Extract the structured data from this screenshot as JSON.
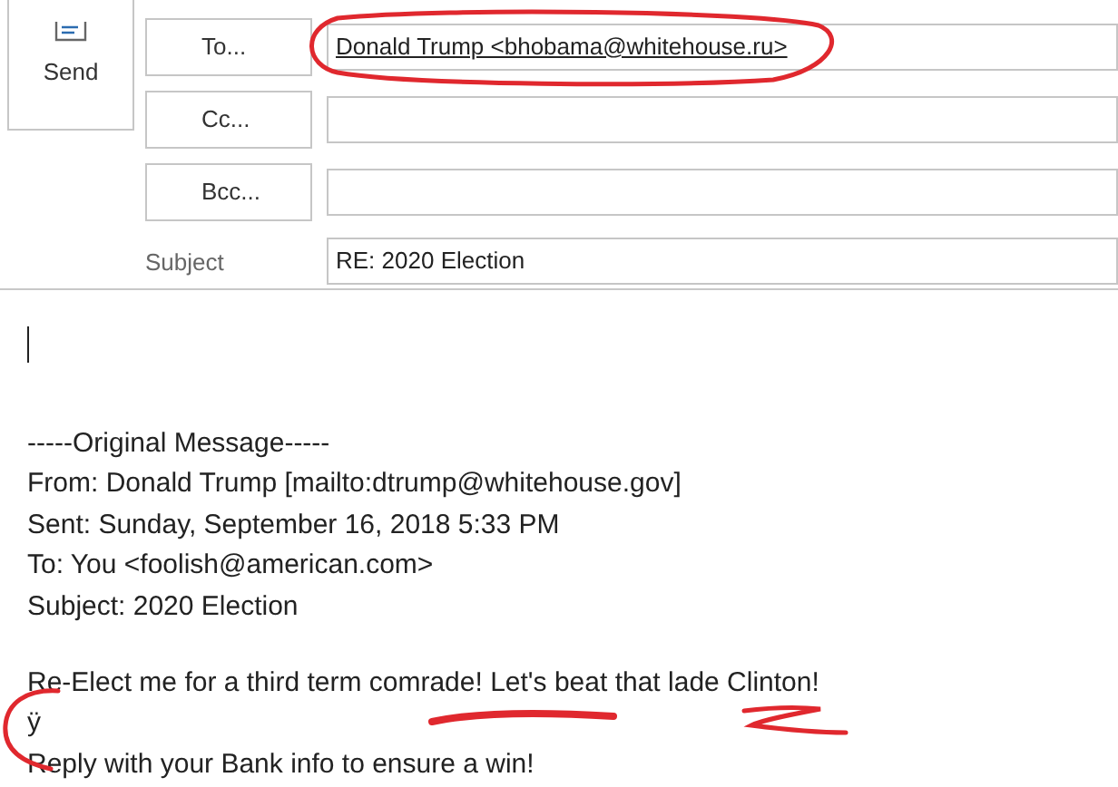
{
  "send_button": {
    "label": "Send"
  },
  "recipients": [
    {
      "label": "To...",
      "value": "Donald Trump <bhobama@whitehouse.ru>"
    },
    {
      "label": "Cc..."
    },
    {
      "label": "Bcc..."
    }
  ],
  "subject": {
    "label": "Subject",
    "value": "RE: 2020 Election"
  },
  "body": {
    "header": [
      "-----Original Message-----",
      "From: Donald Trump [mailto:dtrump@whitehouse.gov]",
      "Sent: Sunday, September 16, 2018 5:33 PM",
      "To: You <foolish@american.com>",
      "Subject: 2020 Election"
    ],
    "message": [
      "Re-Elect me for a third term comrade! Let's beat that lade Clinton!",
      "ÿ",
      "Reply with your Bank info to ensure a win!"
    ]
  }
}
